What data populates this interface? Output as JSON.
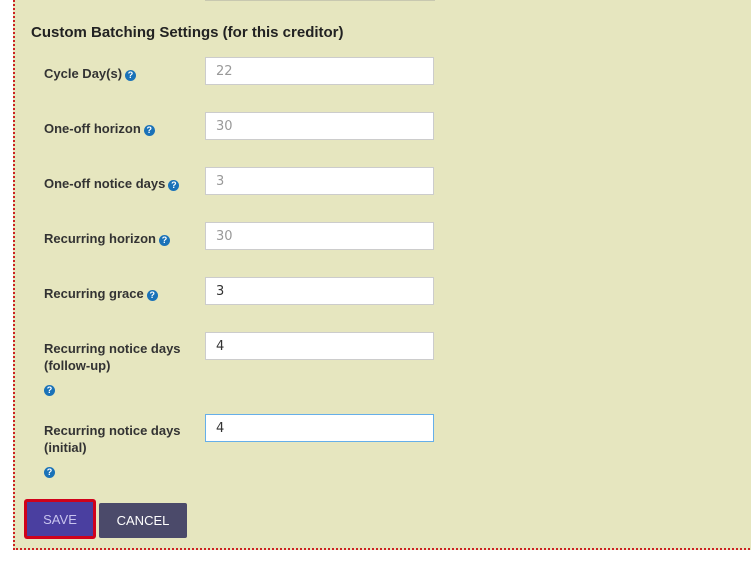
{
  "section": {
    "title": "Custom Batching Settings (for this creditor)"
  },
  "fields": [
    {
      "label": "Cycle Day(s)",
      "value": "22",
      "enabled": false
    },
    {
      "label": "One-off horizon",
      "value": "30",
      "enabled": false
    },
    {
      "label": "One-off notice days",
      "value": "3",
      "enabled": false
    },
    {
      "label": "Recurring horizon",
      "value": "30",
      "enabled": false
    },
    {
      "label": "Recurring grace",
      "value": "3",
      "enabled": true
    },
    {
      "label": "Recurring notice days (follow-up)",
      "value": "4",
      "enabled": true
    },
    {
      "label": "Recurring notice days (initial)",
      "value": "4",
      "enabled": true,
      "focused": true
    }
  ],
  "help_icon": {
    "glyph": "?",
    "name": "help-icon"
  },
  "buttons": {
    "save_label": "SAVE",
    "cancel_label": "CANCEL"
  },
  "colors": {
    "panel_bg": "#e6e6bf",
    "border_dotted": "#cc2222",
    "save_bg": "#4a3fa0",
    "cancel_bg": "#4b4a6a",
    "help_icon": "#1a72b8"
  }
}
